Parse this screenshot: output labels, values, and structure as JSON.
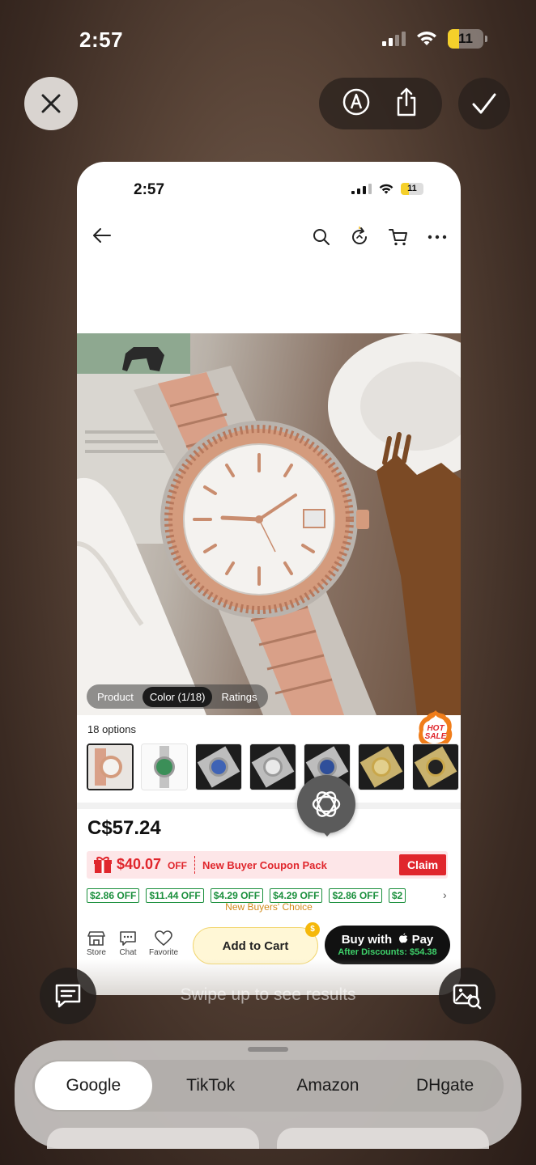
{
  "status_bar": {
    "time": "2:57",
    "battery": "11"
  },
  "toolbar": {
    "close_icon": "close-icon",
    "markup_icon": "markup-pen-icon",
    "share_icon": "share-icon",
    "done_icon": "checkmark-icon"
  },
  "screenshot": {
    "status_bar": {
      "time": "2:57",
      "battery": "11"
    },
    "nav": {
      "icons": [
        "back-arrow-icon",
        "search-icon",
        "refresh-icon",
        "cart-icon",
        "more-icon"
      ]
    },
    "photo_tabs": [
      {
        "label": "Product",
        "active": false
      },
      {
        "label": "Color (1/18)",
        "active": true
      },
      {
        "label": "Ratings",
        "active": false
      }
    ],
    "options_label": "18 options",
    "hot_badge": {
      "line1": "HOT",
      "line2": "SALE"
    },
    "price": "C$57.24",
    "coupon": {
      "amount": "$40.07",
      "off": "OFF",
      "description": "New Buyer Coupon Pack",
      "claim": "Claim"
    },
    "discount_chips": [
      "$2.86 OFF",
      "$11.44 OFF",
      "$4.29 OFF",
      "$4.29 OFF",
      "$2.86 OFF",
      "$2"
    ],
    "buyers_choice": "New Buyers' Choice",
    "bottom_bar": {
      "store": "Store",
      "chat": "Chat",
      "favorite": "Favorite",
      "add_to_cart": "Add to Cart",
      "coin": "$",
      "buy_with": "Buy with",
      "pay": "Pay",
      "after_discounts": "After Discounts: $54.38"
    }
  },
  "swipe_hint": "Swipe up to see results",
  "search_engines": [
    {
      "label": "Google",
      "active": true
    },
    {
      "label": "TikTok",
      "active": false
    },
    {
      "label": "Amazon",
      "active": false
    },
    {
      "label": "DHgate",
      "active": false
    }
  ],
  "colors": {
    "coupon_red": "#e0262c",
    "chip_green": "#1a8f3c",
    "cart_yellow": "#fff7d6"
  }
}
